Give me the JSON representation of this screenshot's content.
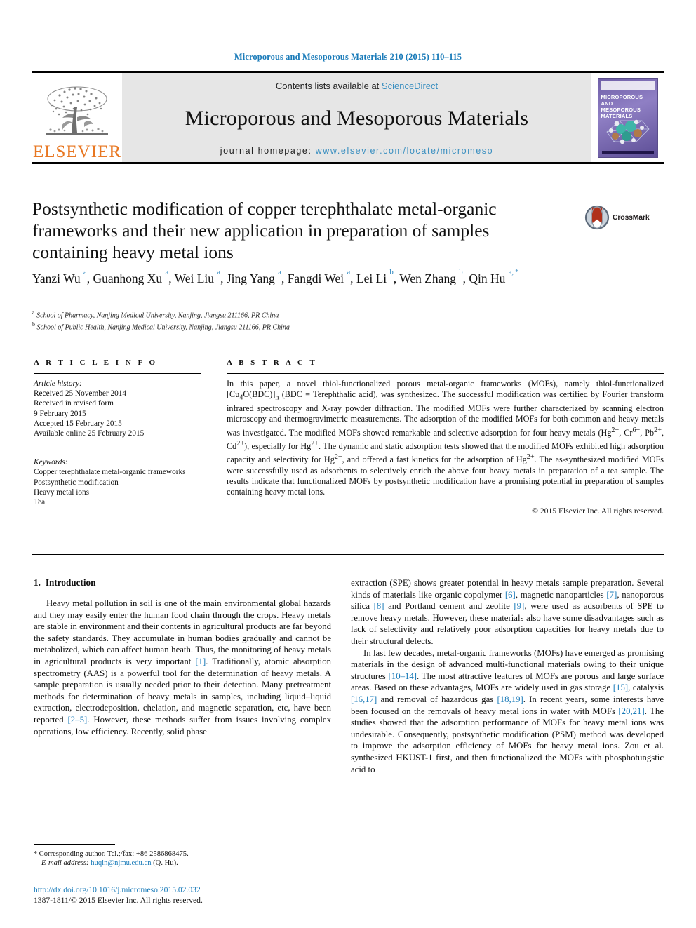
{
  "running_head": "Microporous and Mesoporous Materials 210 (2015) 110–115",
  "masthead": {
    "publisher_name": "ELSEVIER",
    "contents_prefix": "Contents lists available at",
    "contents_link": "ScienceDirect",
    "journal_title": "Microporous and Mesoporous Materials",
    "homepage_label": "journal homepage:",
    "homepage_url": "www.elsevier.com/locate/micromeso",
    "cover": {
      "line1": "MICROPOROUS AND",
      "line2": "MESOPOROUS MATERIALS"
    },
    "accent_link_color": "#3a8fc0",
    "elsevier_orange": "#E87722"
  },
  "article": {
    "title": "Postsynthetic modification of copper terephthalate metal-organic frameworks and their new application in preparation of samples containing heavy metal ions",
    "crossmark_label": "CrossMark",
    "authors_html": "Yanzi Wu <sup>a</sup>, Guanhong Xu <sup>a</sup>, Wei Liu <sup>a</sup>, Jing Yang <sup>a</sup>, Fangdi Wei <sup>a</sup>, Lei Li <sup>b</sup>, Wen Zhang <sup>b</sup>, Qin Hu <sup>a, *</sup>",
    "affiliations": [
      "School of Pharmacy, Nanjing Medical University, Nanjing, Jiangsu 211166, PR China",
      "School of Public Health, Nanjing Medical University, Nanjing, Jiangsu 211166, PR China"
    ],
    "affiliation_marks": [
      "a",
      "b"
    ]
  },
  "article_info": {
    "heading": "A R T I C L E   I N F O",
    "history_label": "Article history:",
    "history": [
      "Received 25 November 2014",
      "Received in revised form",
      "9 February 2015",
      "Accepted 15 February 2015",
      "Available online 25 February 2015"
    ],
    "keywords_label": "Keywords:",
    "keywords": [
      "Copper terephthalate metal-organic frameworks",
      "Postsynthetic modification",
      "Heavy metal ions",
      "Tea"
    ]
  },
  "abstract": {
    "heading": "A B S T R A C T",
    "text_html": "In this paper, a novel thiol-functionalized porous metal-organic frameworks (MOFs), namely thiol-functionalized [Cu<sub>4</sub>O(BDC)]<sub>n</sub> (BDC&nbsp;=&nbsp;Terephthalic acid), was synthesized. The successful modification was certified by Fourier transform infrared spectroscopy and X-ray powder diffraction. The modified MOFs were further characterized by scanning electron microscopy and thermogravimetric measurements. The adsorption of the modified MOFs for both common and heavy metals was investigated. The modified MOFs showed remarkable and selective adsorption for four heavy metals (Hg<sup>2+</sup>, Cr<sup>6+</sup>, Pb<sup>2+</sup>, Cd<sup>2+</sup>), especially for Hg<sup>2+</sup>. The dynamic and static adsorption tests showed that the modified MOFs exhibited high adsorption capacity and selectivity for Hg<sup>2+</sup>, and offered a fast kinetics for the adsorption of Hg<sup>2+</sup>. The as-synthesized modified MOFs were successfully used as adsorbents to selectively enrich the above four heavy metals in preparation of a tea sample. The results indicate that functionalized MOFs by postsynthetic modification have a promising potential in preparation of samples containing heavy metal ions.",
    "copyright": "© 2015 Elsevier Inc. All rights reserved."
  },
  "body": {
    "section_number": "1.",
    "section_title": "Introduction",
    "left_paragraph_html": "Heavy metal pollution in soil is one of the main environmental global hazards and they may easily enter the human food chain through the crops. Heavy metals are stable in environment and their contents in agricultural products are far beyond the safety standards. They accumulate in human bodies gradually and cannot be metabolized, which can affect human heath. Thus, the monitoring of heavy metals in agricultural products is very important <span class=\"ref\">[1]</span>. Traditionally, atomic absorption spectrometry (AAS) is a powerful tool for the determination of heavy metals. A sample preparation is usually needed prior to their detection. Many pretreatment methods for determination of heavy metals in samples, including liquid–liquid extraction, electrodeposition, chelation, and magnetic separation, etc, have been reported <span class=\"ref\">[2–5]</span>. However, these methods suffer from issues involving complex operations, low efficiency. Recently, solid phase",
    "right_paragraph_1_html": "extraction (SPE) shows greater potential in heavy metals sample preparation. Several kinds of materials like organic copolymer <span class=\"ref\">[6]</span>, magnetic nanoparticles <span class=\"ref\">[7]</span>, nanoporous silica <span class=\"ref\">[8]</span> and Portland cement and zeolite <span class=\"ref\">[9]</span>, were used as adsorbents of SPE to remove heavy metals. However, these materials also have some disadvantages such as lack of selectivity and relatively poor adsorption capacities for heavy metals due to their structural defects.",
    "right_paragraph_2_html": "In last few decades, metal-organic frameworks (MOFs) have emerged as promising materials in the design of advanced multi-functional materials owing to their unique structures <span class=\"ref\">[10–14]</span>. The most attractive features of MOFs are porous and large surface areas. Based on these advantages, MOFs are widely used in gas storage <span class=\"ref\">[15]</span>, catalysis <span class=\"ref\">[16,17]</span> and removal of hazardous gas <span class=\"ref\">[18,19]</span>. In recent years, some interests have been focused on the removals of heavy metal ions in water with MOFs <span class=\"ref\">[20,21]</span>. The studies showed that the adsorption performance of MOFs for heavy metal ions was undesirable. Consequently, postsynthetic modification (PSM) method was developed to improve the adsorption efficiency of MOFs for heavy metal ions. Zou et al. synthesized HKUST-1 first, and then functionalized the MOFs with phosphotungstic acid to"
  },
  "footnote": {
    "star": "*",
    "corresponding_text": "Corresponding author. Tel.;/fax: +86 2586868475.",
    "email_label": "E-mail address:",
    "email": "huqin@njmu.edu.cn",
    "email_suffix": "(Q. Hu)."
  },
  "footer": {
    "doi": "http://dx.doi.org/10.1016/j.micromeso.2015.02.032",
    "issn_line": "1387-1811/© 2015 Elsevier Inc. All rights reserved."
  },
  "colors": {
    "link_blue": "#1a7bb9",
    "masthead_gray": "#e6e6e6",
    "elsevier_orange": "#E87722"
  }
}
